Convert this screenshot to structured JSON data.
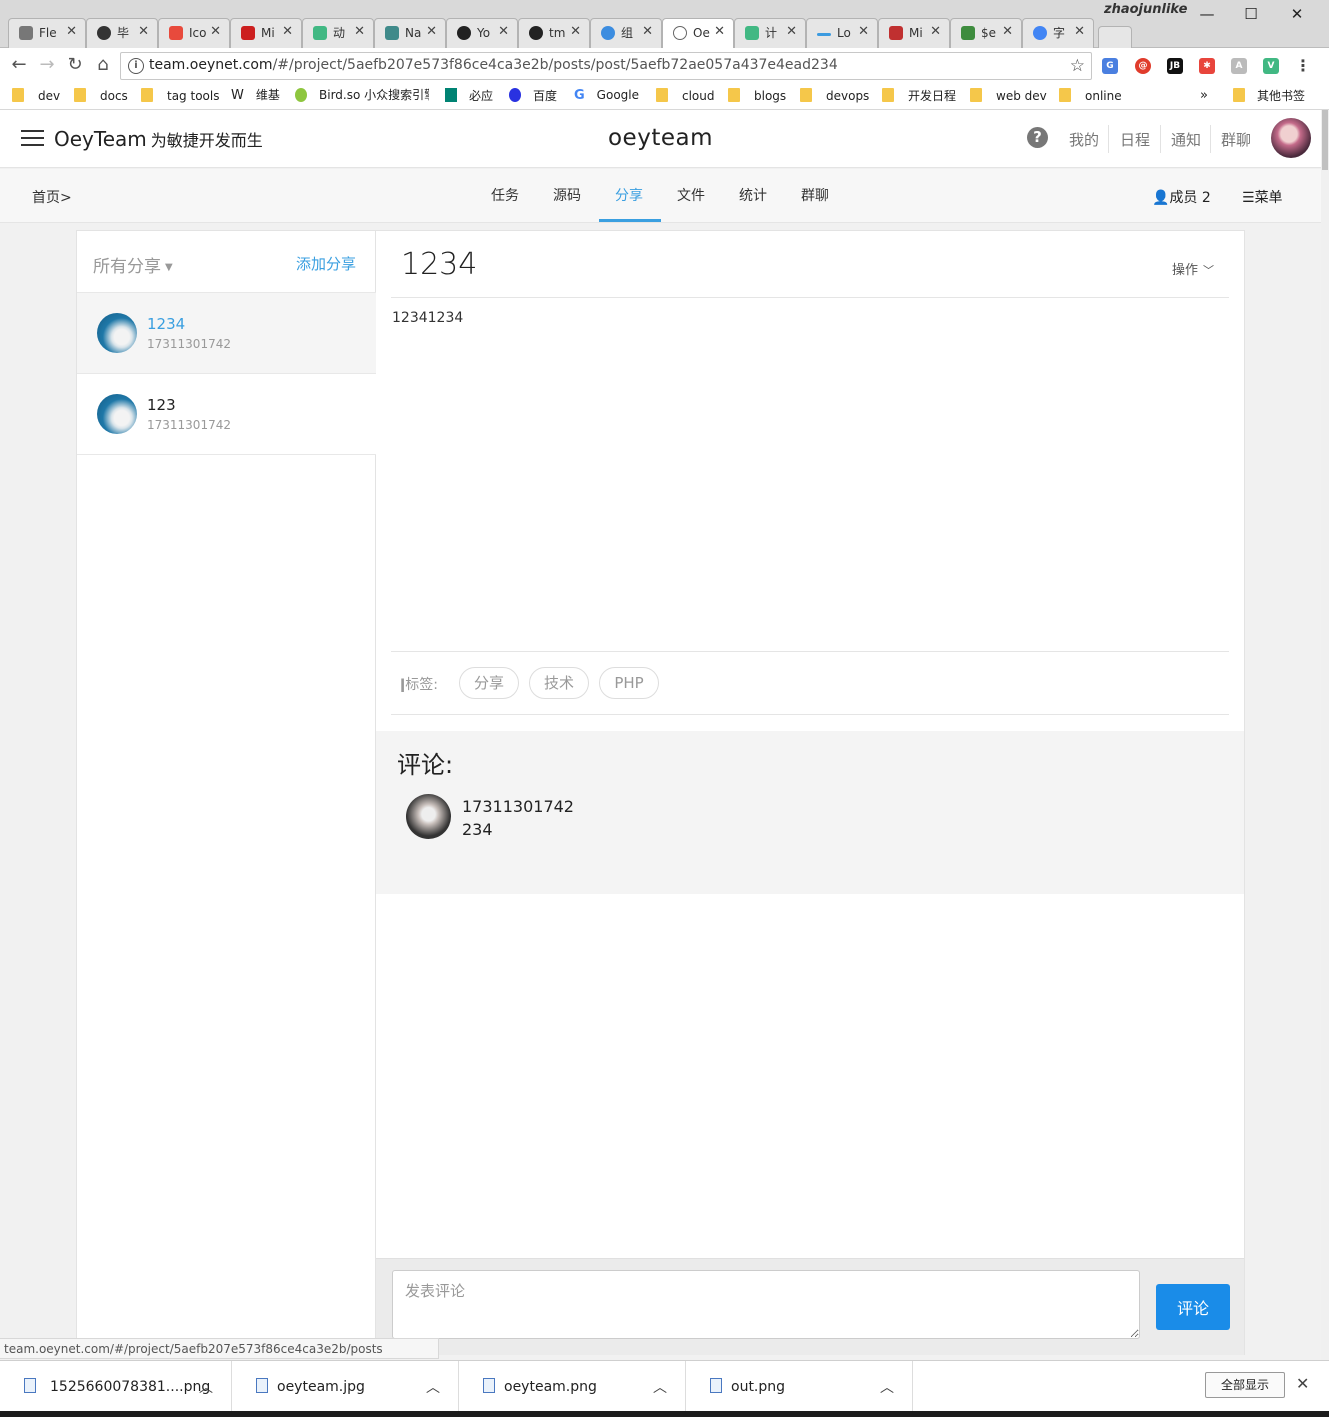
{
  "browser": {
    "user": "zhaojunlike",
    "tabs": [
      {
        "title": "Fle",
        "color": "#777777"
      },
      {
        "title": "毕",
        "color": "#333333"
      },
      {
        "title": "Ico",
        "color": "#e84a3c"
      },
      {
        "title": "Mi",
        "color": "#cc1f1f"
      },
      {
        "title": "动",
        "color": "#41b883"
      },
      {
        "title": "Na",
        "color": "#3f8a8a"
      },
      {
        "title": "Yo",
        "color": "#222222"
      },
      {
        "title": "tm",
        "color": "#222222"
      },
      {
        "title": "组",
        "color": "#3c8de0"
      },
      {
        "title": "Oe",
        "color": "#666666"
      },
      {
        "title": "计",
        "color": "#41b883"
      },
      {
        "title": "Lo",
        "color": "#3c9be0"
      },
      {
        "title": "Mi",
        "color": "#c03030"
      },
      {
        "title": "$e",
        "color": "#3e8c3e"
      },
      {
        "title": "字",
        "color": "#4285f4"
      }
    ],
    "url_host": "team.oeynet.com",
    "url_path": "/#/project/5aefb207e573f86ce4ca3e2b/posts/post/5aefb72ae057a437e4ead234",
    "bookmarks": [
      "dev",
      "docs",
      "tag tools",
      "维基",
      "Bird.so 小众搜索引擎",
      "必应",
      "百度",
      "Google",
      "cloud",
      "blogs",
      "devops",
      "开发日程",
      "web dev",
      "online"
    ],
    "other_bookmarks": "其他书签",
    "overflow": "»",
    "status_url": "team.oeynet.com/#/project/5aefb207e573f86ce4ca3e2b/posts"
  },
  "header": {
    "brand": "OeyTeam",
    "slogan": "为敏捷开发而生",
    "logo": "oeyteam",
    "links": [
      "我的",
      "日程",
      "通知",
      "群聊"
    ]
  },
  "subnav": {
    "breadcrumb": "首页>",
    "tabs": [
      "任务",
      "源码",
      "分享",
      "文件",
      "统计",
      "群聊"
    ],
    "active_tab": "分享",
    "members": "成员 2",
    "menu": "菜单"
  },
  "sidebar": {
    "filter": "所有分享",
    "add": "添加分享",
    "posts": [
      {
        "title": "1234",
        "user": "17311301742",
        "selected": true
      },
      {
        "title": "123",
        "user": "17311301742",
        "selected": false
      }
    ]
  },
  "post": {
    "title": "1234",
    "actions": "操作",
    "body": "12341234",
    "tags_label": "标签:",
    "tags": [
      "分享",
      "技术",
      "PHP"
    ]
  },
  "comments": {
    "title": "评论:",
    "items": [
      {
        "user": "17311301742",
        "text": "234"
      }
    ],
    "placeholder": "发表评论",
    "submit": "评论"
  },
  "downloads": {
    "files": [
      "1525660078381....png",
      "oeyteam.jpg",
      "oeyteam.png",
      "out.png"
    ],
    "show_all": "全部显示"
  },
  "colors": {
    "accent": "#3a9fe0",
    "submit": "#1a8ce8"
  }
}
